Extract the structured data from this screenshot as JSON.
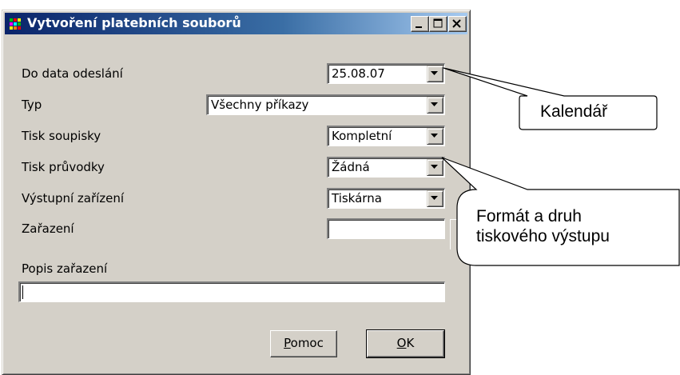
{
  "window": {
    "title": "Vytvoření platebních souborů"
  },
  "form": {
    "date_label": "Do data odeslání",
    "date_value": "25.08.07",
    "type_label": "Typ",
    "type_value": "Všechny příkazy",
    "list_print_label": "Tisk soupisky",
    "list_print_value": "Kompletní",
    "cover_print_label": "Tisk průvodky",
    "cover_print_value": "Žádná",
    "output_device_label": "Výstupní zařízení",
    "output_device_value": "Tiskárna",
    "classification_label": "Zařazení",
    "classification_value": "",
    "classification_desc_label": "Popis zařazení",
    "classification_desc_value": ""
  },
  "buttons": {
    "help_mnemonic": "P",
    "help_rest": "omoc",
    "ok_mnemonic": "O",
    "ok_rest": "K"
  },
  "callouts": {
    "calendar": "Kalendář",
    "format_line1": "Formát a druh",
    "format_line2": "tiskového výstupu"
  }
}
